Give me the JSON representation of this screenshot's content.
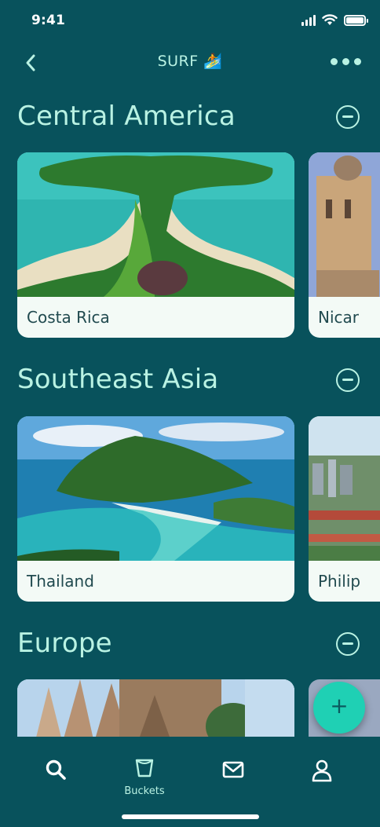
{
  "status_bar": {
    "time": "9:41"
  },
  "nav": {
    "title": "SURF 🏄"
  },
  "sections": [
    {
      "title": "Central America",
      "cards": [
        {
          "label": "Costa Rica"
        },
        {
          "label": "Nicar"
        }
      ]
    },
    {
      "title": "Southeast Asia",
      "cards": [
        {
          "label": "Thailand"
        },
        {
          "label": "Philip"
        }
      ]
    },
    {
      "title": "Europe",
      "cards": []
    }
  ],
  "fab": {
    "icon": "plus-icon",
    "glyph": "+"
  },
  "tab_bar": {
    "items": [
      {
        "icon": "search-icon",
        "label": ""
      },
      {
        "icon": "bucket-icon",
        "label": "Buckets"
      },
      {
        "icon": "mail-icon",
        "label": ""
      },
      {
        "icon": "user-icon",
        "label": ""
      }
    ]
  },
  "colors": {
    "background": "#08525c",
    "accent": "#b9f2e3",
    "fab": "#1fd0b4",
    "card": "#f3faf6"
  }
}
